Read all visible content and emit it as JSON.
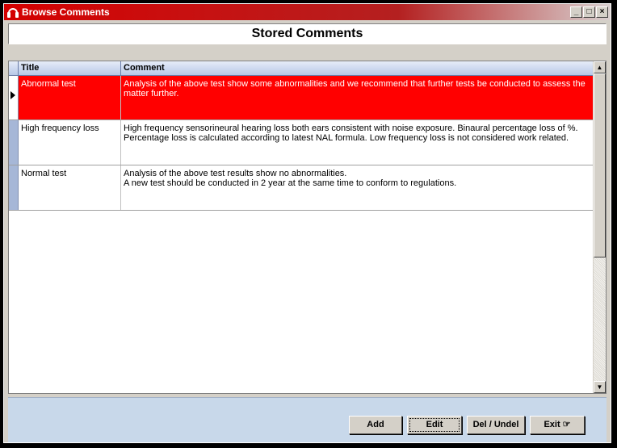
{
  "window": {
    "title": "Browse Comments",
    "controls": [
      "_",
      "□",
      "×"
    ]
  },
  "header": {
    "title": "Stored Comments"
  },
  "grid": {
    "columns": [
      "Title",
      "Comment"
    ],
    "rows": [
      {
        "title": "Abnormal test",
        "comment": "Analysis of the above test show some abnormalities and we recommend that further tests be conducted to assess the matter further.",
        "selected": true
      },
      {
        "title": "High frequency loss",
        "comment": "High frequency sensorineural hearing loss both ears consistent with noise exposure. Binaural percentage loss of  %. Percentage loss is calculated according to latest NAL formula. Low frequency loss is not considered work related.",
        "selected": false
      },
      {
        "title": "Normal test",
        "comment": "Analysis of the above test results show no abnormalities.\nA new test should be conducted in 2 year at the same time to conform to regulations.",
        "selected": false
      }
    ]
  },
  "buttons": {
    "add": "Add",
    "edit": "Edit",
    "del": "Del / Undel",
    "exit": "Exit ☞"
  },
  "colors": {
    "selected_row": "#ff0000",
    "title_bar": "#d40000",
    "footer": "#c8d8ea"
  },
  "icons": {
    "app": "headphones-icon",
    "pointer": "pointing-hand-icon"
  }
}
